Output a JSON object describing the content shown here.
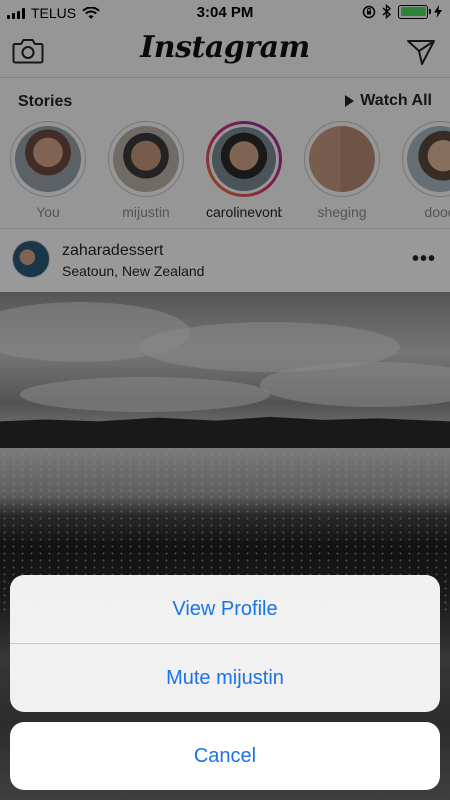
{
  "status_bar": {
    "carrier": "TELUS",
    "time": "3:04 PM",
    "battery_level": 1.0,
    "icons": [
      "signal-icon",
      "wifi-icon",
      "rotation-lock-icon",
      "bluetooth-icon",
      "battery-icon",
      "charging-icon"
    ]
  },
  "nav": {
    "logo": "Instagram",
    "icons": [
      "camera-icon",
      "direct-message-icon"
    ]
  },
  "stories": {
    "title": "Stories",
    "watch_all": "Watch All",
    "items": [
      {
        "label": "You",
        "seen": true
      },
      {
        "label": "mijustin",
        "seen": true
      },
      {
        "label": "carolinevonb",
        "seen": false
      },
      {
        "label": "sheging",
        "seen": true
      },
      {
        "label": "dooo",
        "seen": true
      }
    ]
  },
  "post": {
    "username": "zaharadessert",
    "location": "Seatoun, New Zealand",
    "more": "•••"
  },
  "action_sheet": {
    "options": [
      "View Profile",
      "Mute mijustin"
    ],
    "cancel": "Cancel",
    "accent_color": "#1a73e8"
  }
}
